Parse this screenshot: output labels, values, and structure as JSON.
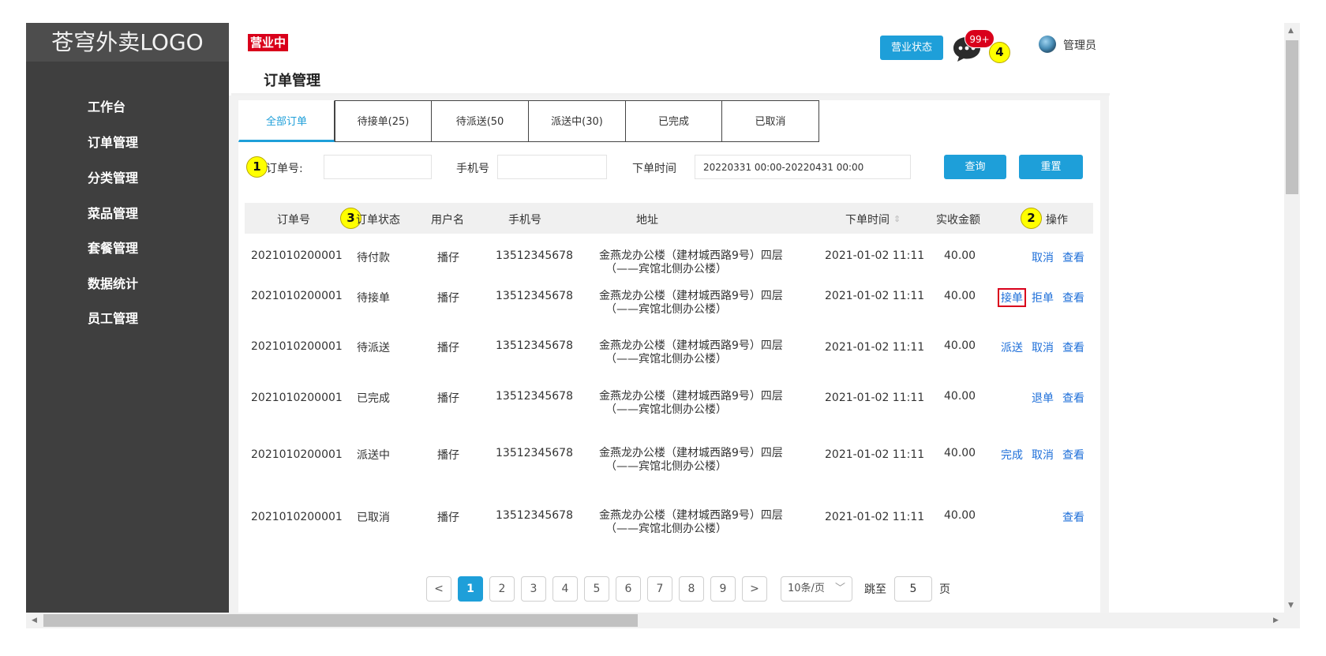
{
  "sidebar": {
    "logo": "苍穹外卖LOGO",
    "items": [
      {
        "label": "工作台"
      },
      {
        "label": "订单管理"
      },
      {
        "label": "分类管理"
      },
      {
        "label": "菜品管理"
      },
      {
        "label": "套餐管理"
      },
      {
        "label": "数据统计"
      },
      {
        "label": "员工管理"
      }
    ]
  },
  "header": {
    "open_badge": "营业中",
    "page_title": "订单管理",
    "status_button": "营业状态",
    "message_badge": "99+",
    "user_name": "管理员"
  },
  "markers": [
    "1",
    "2",
    "3",
    "4"
  ],
  "tabs": [
    {
      "label": "全部订单"
    },
    {
      "label": "待接单(25)"
    },
    {
      "label": "待派送(50"
    },
    {
      "label": "派送中(30)"
    },
    {
      "label": "已完成"
    },
    {
      "label": "已取消"
    }
  ],
  "filters": {
    "order_no_label": "订单号:",
    "order_no_value": "",
    "phone_label": "手机号",
    "phone_value": "",
    "time_label": "下单时间",
    "time_value": "20220331 00:00-20220431 00:00",
    "search_button": "查询",
    "reset_button": "重置"
  },
  "table": {
    "columns": [
      "订单号",
      "订单状态",
      "用户名",
      "手机号",
      "地址",
      "下单时间",
      "实收金额",
      "操作"
    ],
    "sort_icon": "sort-icon",
    "rows": [
      {
        "order_no": "2021010200001",
        "status": "待付款",
        "user": "播仔",
        "phone": "13512345678",
        "addr1": "金燕龙办公楼（建材城西路9号）四层",
        "addr2": "（——宾馆北侧办公楼）",
        "time": "2021-01-02 11:11",
        "amount": "40.00",
        "actions": [
          "取消",
          "查看"
        ]
      },
      {
        "order_no": "2021010200001",
        "status": "待接单",
        "user": "播仔",
        "phone": "13512345678",
        "addr1": "金燕龙办公楼（建材城西路9号）四层",
        "addr2": "（——宾馆北侧办公楼）",
        "time": "2021-01-02 11:11",
        "amount": "40.00",
        "actions": [
          "接单",
          "拒单",
          "查看"
        ]
      },
      {
        "order_no": "2021010200001",
        "status": "待派送",
        "user": "播仔",
        "phone": "13512345678",
        "addr1": "金燕龙办公楼（建材城西路9号）四层",
        "addr2": "（——宾馆北侧办公楼）",
        "time": "2021-01-02 11:11",
        "amount": "40.00",
        "actions": [
          "派送",
          "取消",
          "查看"
        ]
      },
      {
        "order_no": "2021010200001",
        "status": "已完成",
        "user": "播仔",
        "phone": "13512345678",
        "addr1": "金燕龙办公楼（建材城西路9号）四层",
        "addr2": "（——宾馆北侧办公楼）",
        "time": "2021-01-02 11:11",
        "amount": "40.00",
        "actions": [
          "退单",
          "查看"
        ]
      },
      {
        "order_no": "2021010200001",
        "status": "派送中",
        "user": "播仔",
        "phone": "13512345678",
        "addr1": "金燕龙办公楼（建材城西路9号）四层",
        "addr2": "（——宾馆北侧办公楼）",
        "time": "2021-01-02 11:11",
        "amount": "40.00",
        "actions": [
          "完成",
          "取消",
          "查看"
        ]
      },
      {
        "order_no": "2021010200001",
        "status": "已取消",
        "user": "播仔",
        "phone": "13512345678",
        "addr1": "金燕龙办公楼（建材城西路9号）四层",
        "addr2": "（——宾馆北侧办公楼）",
        "time": "2021-01-02 11:11",
        "amount": "40.00",
        "actions": [
          "查看"
        ]
      }
    ]
  },
  "pagination": {
    "prev": "<",
    "pages": [
      "1",
      "2",
      "3",
      "4",
      "5",
      "6",
      "7",
      "8",
      "9"
    ],
    "next": ">",
    "page_size": "10条/页",
    "jump_label": "跳至",
    "jump_value": "5",
    "page_suffix": "页"
  },
  "colors": {
    "accent": "#1e9fd9",
    "sidebar_bg": "#3f3f3f",
    "badge_red": "#d9001b",
    "marker_yellow": "#ffff00"
  }
}
